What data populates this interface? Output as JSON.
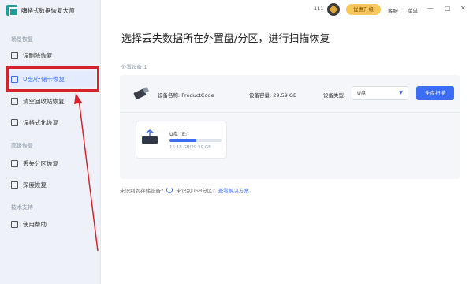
{
  "app": {
    "title": "嗨格式数据恢复大师"
  },
  "topbar": {
    "count": "111",
    "vip_label": "优惠升级",
    "service_label": "客服",
    "menu_label": "菜单",
    "minimize": "—",
    "maximize": "▢",
    "close": "✕"
  },
  "sidebar": {
    "scenario_label": "场景恢复",
    "items": [
      {
        "label": "误删除恢复"
      },
      {
        "label": "U盘/存储卡恢复"
      },
      {
        "label": "清空回收站恢复"
      },
      {
        "label": "误格式化恢复"
      }
    ],
    "advanced_label": "高级恢复",
    "advanced_items": [
      {
        "label": "丢失分区恢复"
      },
      {
        "label": "深度恢复"
      }
    ],
    "support_label": "技术支持",
    "support_items": [
      {
        "label": "使用帮助"
      }
    ]
  },
  "main": {
    "title": "选择丢失数据所在外置盘/分区，进行扫描恢复",
    "external_label": "外置设备 1",
    "device": {
      "name_label": "设备名称: ProductCode",
      "capacity_label": "设备容量: 29.59 GB",
      "type_label": "设备类型:",
      "type_value": "U盘",
      "scan_button": "全盘扫描"
    },
    "drive": {
      "name": "U盘 (E:)",
      "size": "15.18 GB/29.59 GB",
      "used_fraction": 0.51
    },
    "note_prefix": "未识别到存储设备?",
    "note_usb": "未识别USB分区?",
    "note_link": "查看解决方案"
  },
  "colors": {
    "accent": "#3d6cf5",
    "highlight": "#d6232b",
    "vip": "#f6c95a"
  }
}
